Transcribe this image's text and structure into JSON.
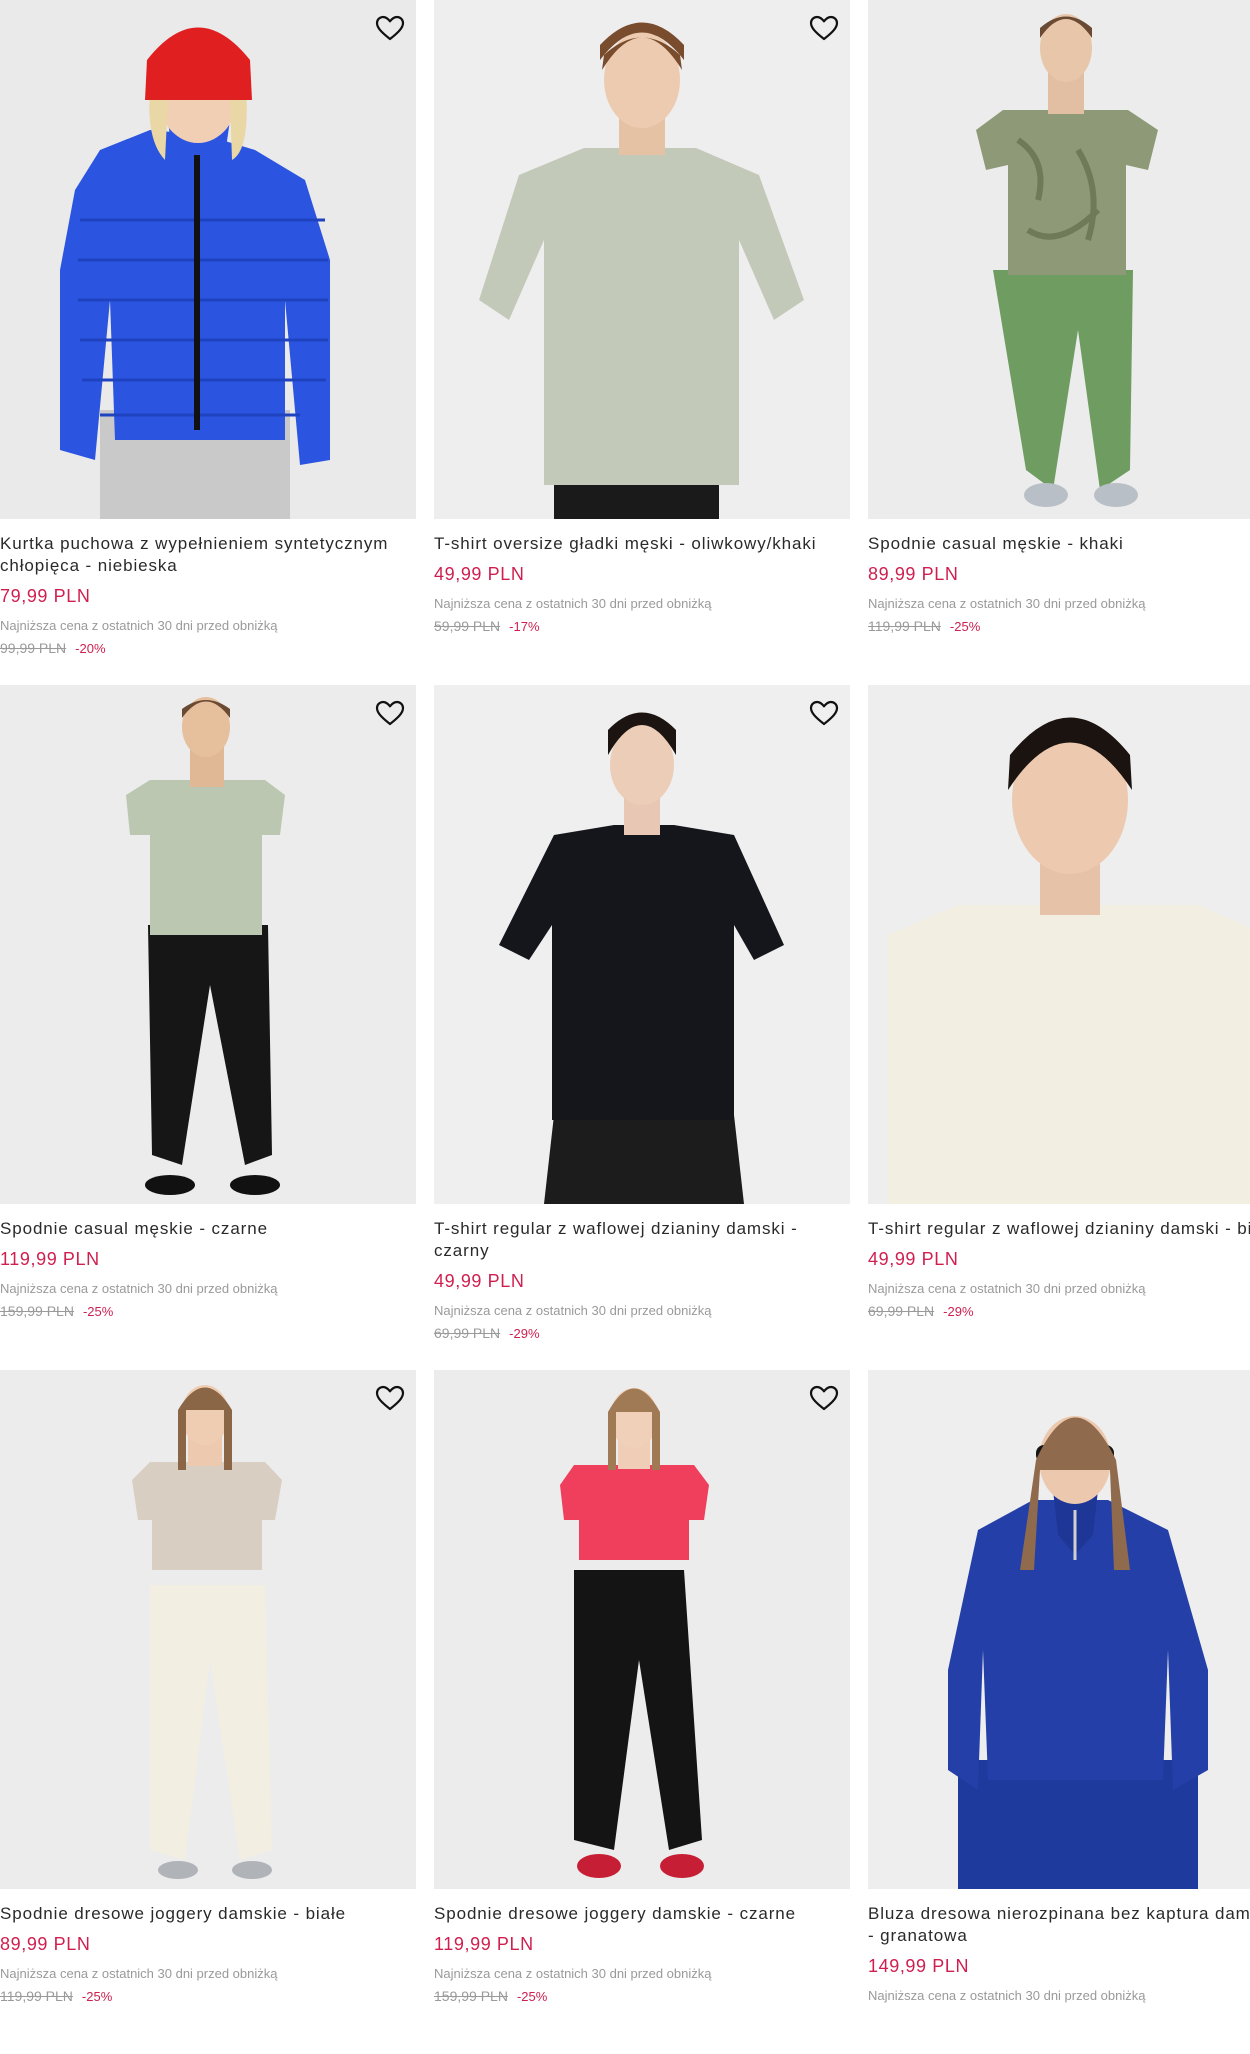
{
  "colors": {
    "price_accent": "#cf1f4f",
    "muted_text": "#9a9a9a",
    "image_bg": "#ebebeb"
  },
  "icons": {
    "wishlist": "heart-outline-icon"
  },
  "products": [
    {
      "name": "Kurtka puchowa z wypełnieniem syntetycznym chłopięca - niebieska",
      "price": "79,99 PLN",
      "lowest_note": "Najniższa cena z ostatnich 30 dni przed obniżką",
      "old_price": "99,99 PLN",
      "discount": "-20%",
      "image": "boy-blue-puffer-jacket-red-beanie"
    },
    {
      "name": "T-shirt oversize gładki męski - oliwkowy/khaki",
      "price": "49,99 PLN",
      "lowest_note": "Najniższa cena z ostatnich 30 dni przed obniżką",
      "old_price": "59,99 PLN",
      "discount": "-17%",
      "image": "man-olive-oversize-tshirt"
    },
    {
      "name": "Spodnie casual męskie - khaki",
      "price": "89,99 PLN",
      "lowest_note": "Najniższa cena z ostatnich 30 dni przed obniżką",
      "old_price": "119,99 PLN",
      "discount": "-25%",
      "image": "man-khaki-pants-camo-tshirt"
    },
    {
      "name": "Spodnie casual męskie - czarne",
      "price": "119,99 PLN",
      "lowest_note": "Najniższa cena z ostatnich 30 dni przed obniżką",
      "old_price": "159,99 PLN",
      "discount": "-25%",
      "image": "man-black-pants-sage-tshirt"
    },
    {
      "name": "T-shirt regular z waflowej dzianiny damski - czarny",
      "price": "49,99 PLN",
      "lowest_note": "Najniższa cena z ostatnich 30 dni przed obniżką",
      "old_price": "69,99 PLN",
      "discount": "-29%",
      "image": "woman-black-waffle-tshirt"
    },
    {
      "name": "T-shirt regular z waflowej dzianiny damski - biały",
      "price": "49,99 PLN",
      "lowest_note": "Najniższa cena z ostatnich 30 dni przed obniżką",
      "old_price": "69,99 PLN",
      "discount": "-29%",
      "image": "woman-white-waffle-tshirt"
    },
    {
      "name": "Spodnie dresowe joggery damskie - białe",
      "price": "89,99 PLN",
      "lowest_note": "Najniższa cena z ostatnich 30 dni przed obniżką",
      "old_price": "119,99 PLN",
      "discount": "-25%",
      "image": "woman-white-joggers-beige-top"
    },
    {
      "name": "Spodnie dresowe joggery damskie - czarne",
      "price": "119,99 PLN",
      "lowest_note": "Najniższa cena z ostatnich 30 dni przed obniżką",
      "old_price": "159,99 PLN",
      "discount": "-25%",
      "image": "woman-black-joggers-pink-top"
    },
    {
      "name": "Bluza dresowa nierozpinana bez kaptura damska - granatowa",
      "price": "149,99 PLN",
      "lowest_note": "Najniższa cena z ostatnich 30 dni przed obniżką",
      "old_price": "",
      "discount": "",
      "image": "woman-navy-half-zip-sweatshirt-sunglasses"
    }
  ]
}
